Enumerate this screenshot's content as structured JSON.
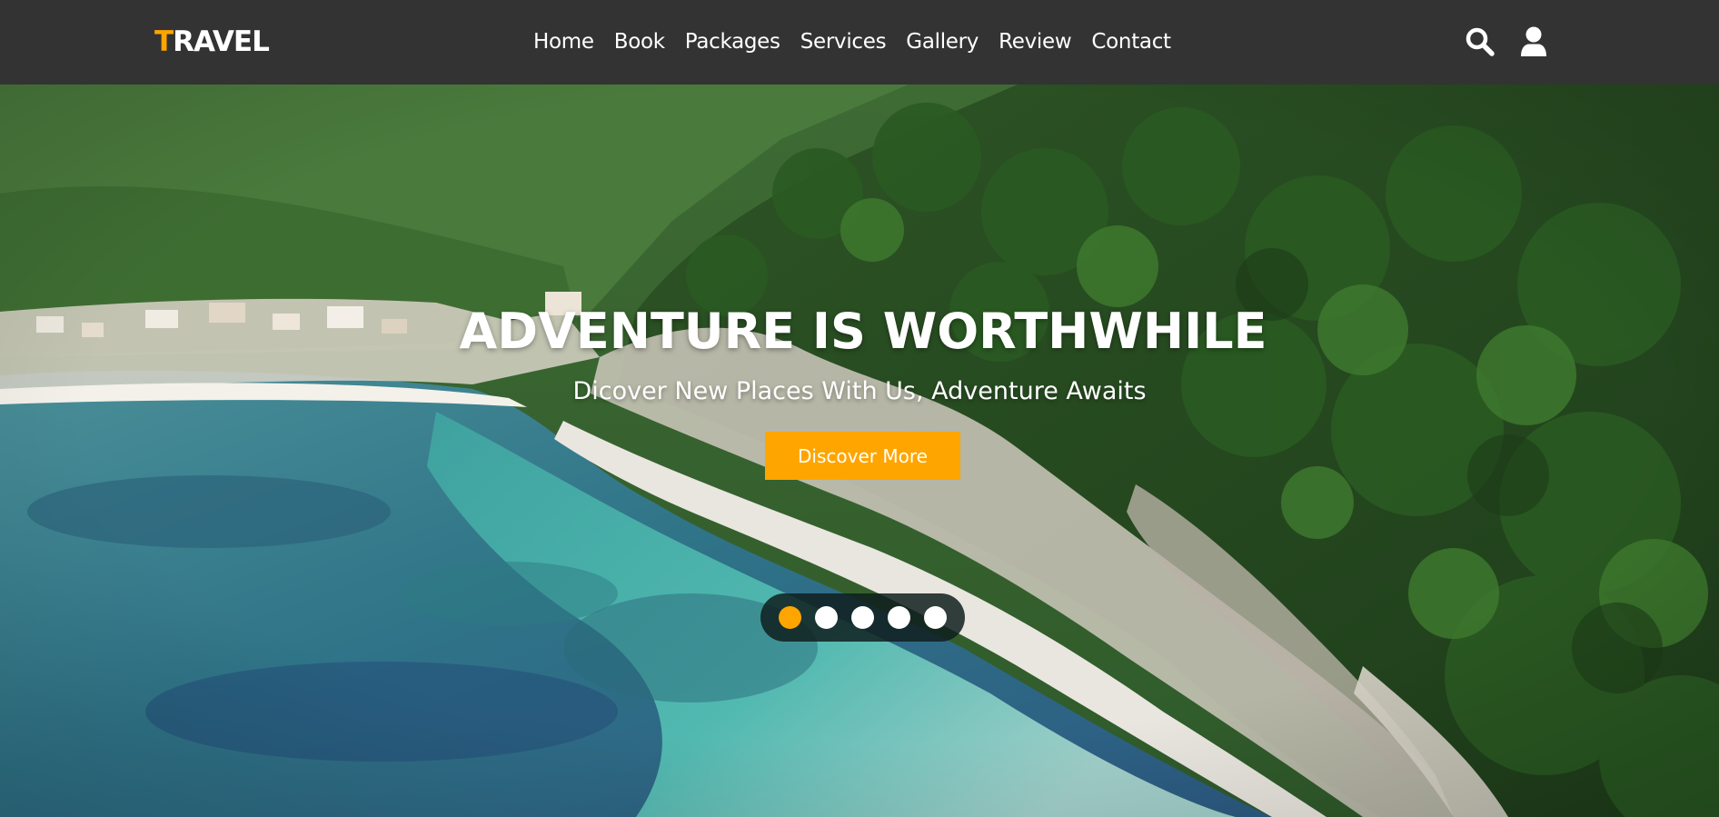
{
  "brand": {
    "logo_first_letter": "T",
    "logo_rest": "RAVEL",
    "accent_color": "#ffa500",
    "navbar_color": "#333333"
  },
  "nav": {
    "links": [
      {
        "label": "Home"
      },
      {
        "label": "Book"
      },
      {
        "label": "Packages"
      },
      {
        "label": "Services"
      },
      {
        "label": "Gallery"
      },
      {
        "label": "Review"
      },
      {
        "label": "Contact"
      }
    ],
    "icons": [
      "search-icon",
      "user-icon"
    ]
  },
  "hero": {
    "title": "ADVENTURE IS WORTHWHILE",
    "subtitle": "Dicover New Places With Us, Adventure Awaits",
    "button_label": "Discover More",
    "slides": {
      "count": 5,
      "active_index": 0
    }
  }
}
